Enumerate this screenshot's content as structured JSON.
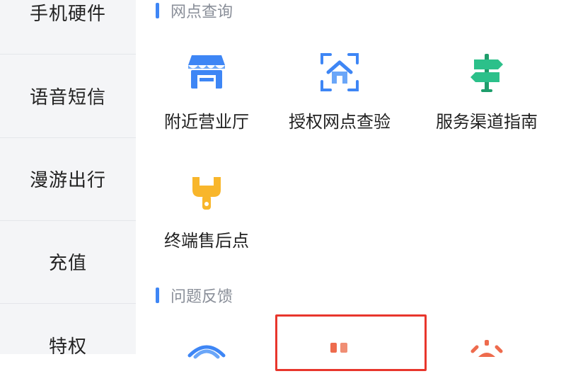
{
  "sidebar": {
    "items": [
      {
        "label": "手机硬件"
      },
      {
        "label": "语音短信"
      },
      {
        "label": "漫游出行"
      },
      {
        "label": "充值"
      },
      {
        "label": "特权"
      }
    ]
  },
  "sections": {
    "outlet": {
      "title": "网点查询",
      "items": [
        {
          "label": "附近营业厅",
          "icon": "storefront-icon"
        },
        {
          "label": "授权网点查验",
          "icon": "house-scan-icon"
        },
        {
          "label": "服务渠道指南",
          "icon": "signpost-icon"
        },
        {
          "label": "终端售后点",
          "icon": "wrench-icon"
        }
      ]
    },
    "feedback": {
      "title": "问题反馈",
      "items": [
        {
          "icon": "feedback-eye-icon"
        },
        {
          "icon": "feedback-report-icon"
        },
        {
          "icon": "feedback-bulb-icon"
        }
      ]
    }
  },
  "colors": {
    "accent_blue": "#3e86f5",
    "accent_yellow": "#f8b62b",
    "accent_green": "#2cc08a",
    "accent_red": "#e8362c",
    "highlight_border": "#e8362c"
  }
}
